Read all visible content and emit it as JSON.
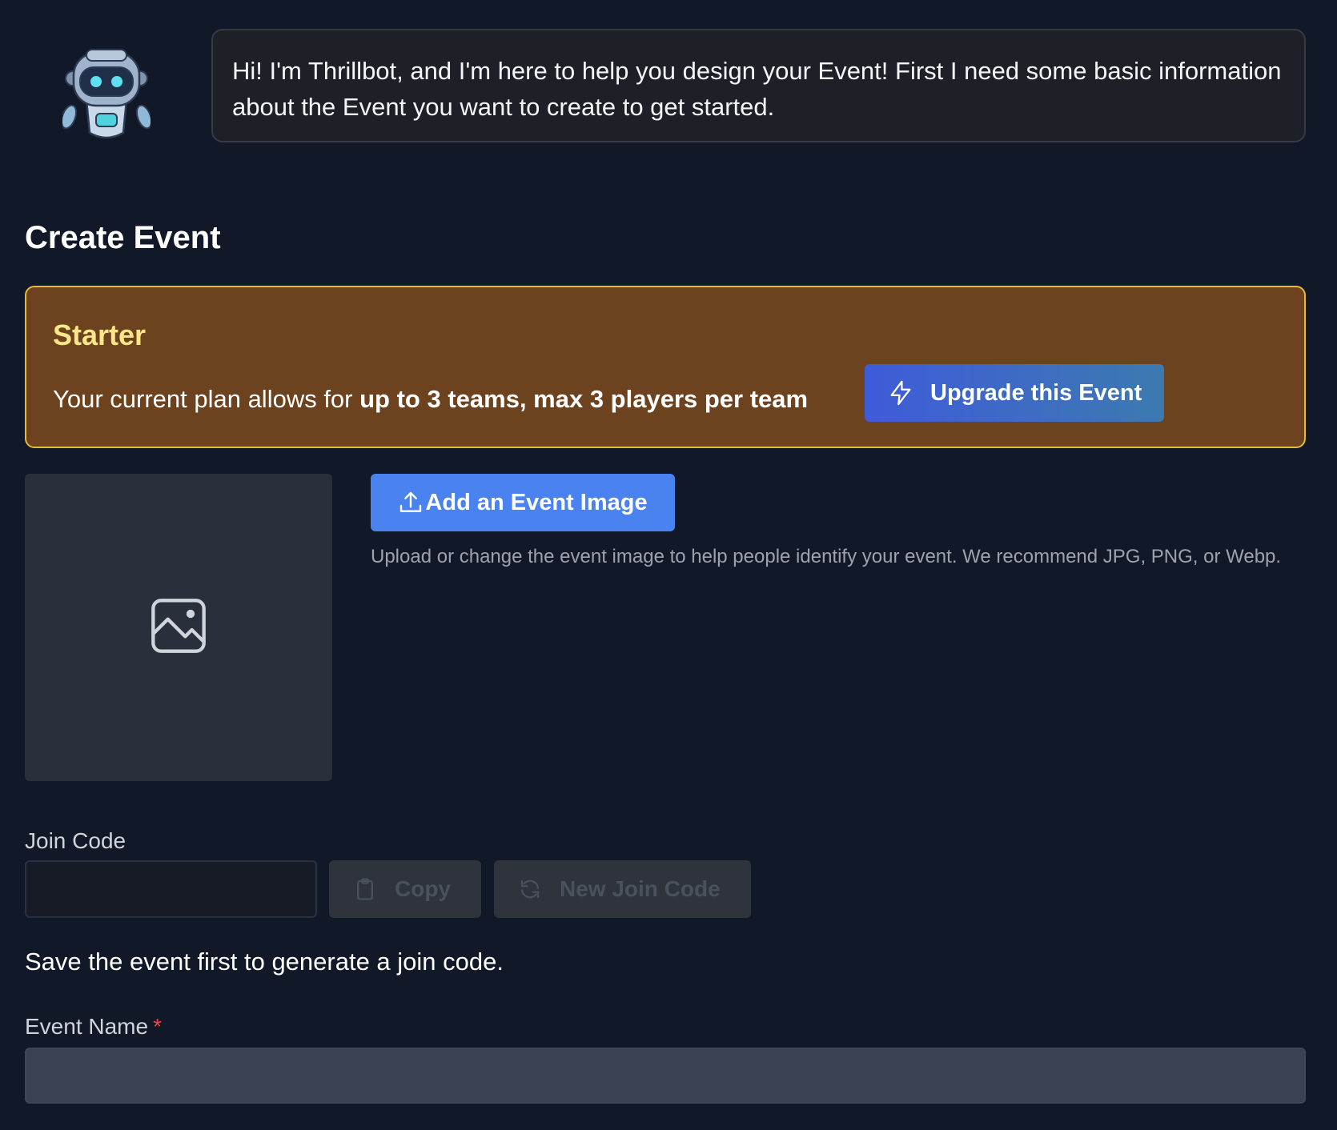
{
  "bot": {
    "avatar_icon": "robot-mascot-icon",
    "message": "Hi! I'm Thrillbot, and I'm here to help you design your Event! First I need some basic information about the Event you want to create to get started."
  },
  "page_title": "Create Event",
  "plan": {
    "name": "Starter",
    "description_prefix": "Your current plan allows for ",
    "description_emphasis": "up to 3 teams, max 3 players per team",
    "upgrade_label": "Upgrade this Event",
    "upgrade_icon": "lightning-bolt-icon",
    "colors": {
      "background": "#6d421e",
      "border": "#e8b936",
      "title": "#fde68a"
    }
  },
  "event_image": {
    "placeholder_icon": "image-placeholder-icon",
    "button_label": "Add an Event Image",
    "button_icon": "upload-icon",
    "help_text": "Upload or change the event image to help people identify your event. We recommend JPG, PNG, or Webp."
  },
  "join_code": {
    "label": "Join Code",
    "value": "",
    "copy_label": "Copy",
    "copy_icon": "clipboard-icon",
    "new_code_label": "New Join Code",
    "new_code_icon": "refresh-icon",
    "note": "Save the event first to generate a join code."
  },
  "event_name": {
    "label": "Event Name",
    "required_mark": "*",
    "value": ""
  },
  "colors": {
    "page_background": "#111827",
    "primary_button": "#4a82f0",
    "required": "#ef4444"
  }
}
